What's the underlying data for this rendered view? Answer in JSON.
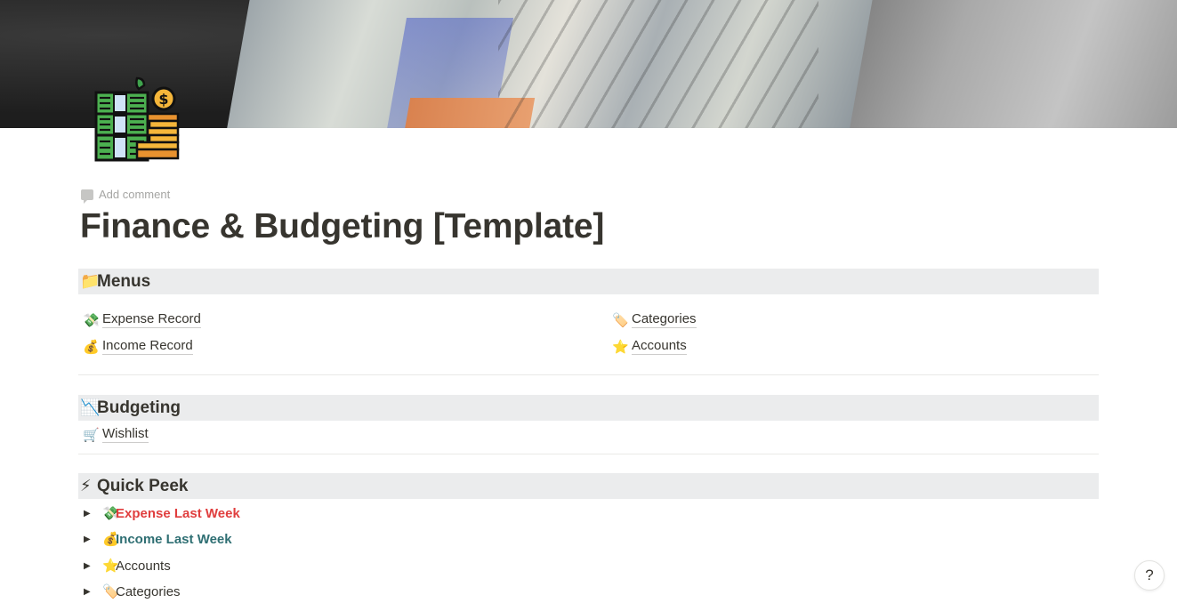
{
  "page": {
    "title": "Finance & Budgeting [Template]",
    "add_comment": "Add comment",
    "page_icon": "money-stacks-coins-icon"
  },
  "sections": {
    "menus": {
      "emoji": "📁",
      "title": "Menus",
      "left_links": [
        {
          "emoji": "💸",
          "label": "Expense Record"
        },
        {
          "emoji": "💰",
          "label": "Income Record"
        }
      ],
      "right_links": [
        {
          "emoji": "🏷️",
          "label": "Categories"
        },
        {
          "emoji": "⭐",
          "label": "Accounts"
        }
      ]
    },
    "budgeting": {
      "emoji": "📉",
      "title": "Budgeting",
      "links": [
        {
          "emoji": "🛒",
          "label": "Wishlist"
        }
      ]
    },
    "quick_peek": {
      "emoji": "⚡",
      "title": "Quick Peek",
      "toggles": [
        {
          "emoji": "💸",
          "label": "Expense Last Week",
          "color": "#e03e3e"
        },
        {
          "emoji": "💰",
          "label": "Income Last Week",
          "color": "#2f6f73"
        },
        {
          "emoji": "⭐",
          "label": "Accounts",
          "color": "#37352f"
        },
        {
          "emoji": "🏷️",
          "label": "Categories",
          "color": "#37352f"
        }
      ]
    }
  },
  "help": {
    "label": "?"
  },
  "toggle_glyph": "▶"
}
